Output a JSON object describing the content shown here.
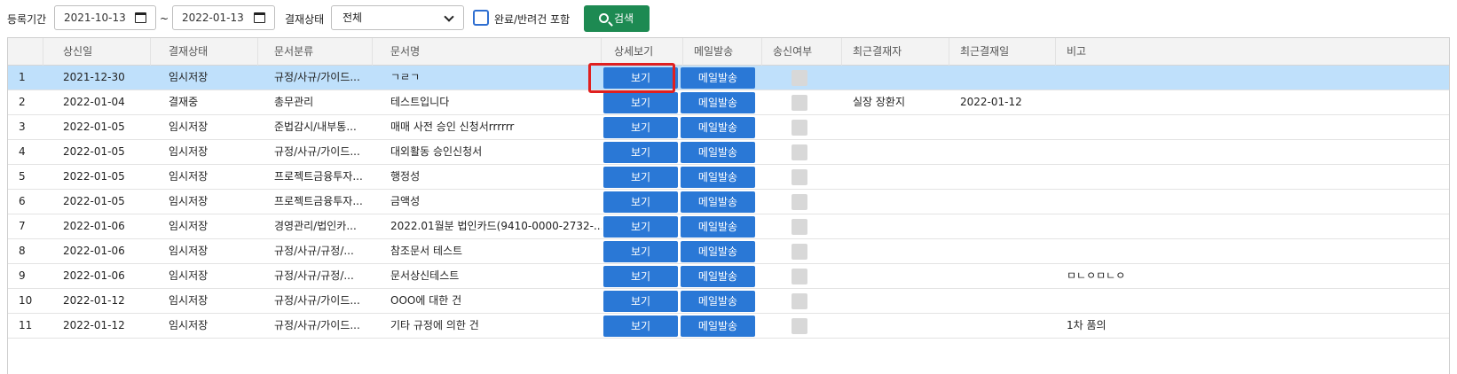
{
  "filter": {
    "period_label": "등록기간",
    "start_date": "2021-10-13",
    "tilde": "~",
    "end_date": "2022-01-13",
    "status_label": "결재상태",
    "status_value": "전체",
    "include_label": "완료/반려건 포함",
    "search_label": "검색"
  },
  "table": {
    "headers": [
      "상신일",
      "결재상태",
      "문서분류",
      "문서명",
      "상세보기",
      "메일발송",
      "송신여부",
      "최근결재자",
      "최근결재일",
      "비고"
    ],
    "view_label": "보기",
    "mail_label": "메일발송",
    "rows": [
      {
        "no": "1",
        "date": "2021-12-30",
        "status": "임시저장",
        "category": "규정/사규/가이드...",
        "name": "ㄱㄹㄱ",
        "approver": "",
        "approved_date": "",
        "note": ""
      },
      {
        "no": "2",
        "date": "2022-01-04",
        "status": "결재중",
        "category": "총무관리",
        "name": "테스트입니다",
        "approver": "실장 장환지",
        "approved_date": "2022-01-12",
        "note": ""
      },
      {
        "no": "3",
        "date": "2022-01-05",
        "status": "임시저장",
        "category": "준법감시/내부통...",
        "name": "매매 사전 승인 신청서rrrrrr",
        "approver": "",
        "approved_date": "",
        "note": ""
      },
      {
        "no": "4",
        "date": "2022-01-05",
        "status": "임시저장",
        "category": "규정/사규/가이드...",
        "name": "대외활동 승인신청서",
        "approver": "",
        "approved_date": "",
        "note": ""
      },
      {
        "no": "5",
        "date": "2022-01-05",
        "status": "임시저장",
        "category": "프로젝트금융투자...",
        "name": "행정성",
        "approver": "",
        "approved_date": "",
        "note": ""
      },
      {
        "no": "6",
        "date": "2022-01-05",
        "status": "임시저장",
        "category": "프로젝트금융투자...",
        "name": "금액성",
        "approver": "",
        "approved_date": "",
        "note": ""
      },
      {
        "no": "7",
        "date": "2022-01-06",
        "status": "임시저장",
        "category": "경영관리/법인카...",
        "name": "2022.01월분 법인카드(9410-0000-2732-...",
        "approver": "",
        "approved_date": "",
        "note": ""
      },
      {
        "no": "8",
        "date": "2022-01-06",
        "status": "임시저장",
        "category": "규정/사규/규정/...",
        "name": "참조문서 테스트",
        "approver": "",
        "approved_date": "",
        "note": ""
      },
      {
        "no": "9",
        "date": "2022-01-06",
        "status": "임시저장",
        "category": "규정/사규/규정/...",
        "name": "문서상신테스트",
        "approver": "",
        "approved_date": "",
        "note": "ㅁㄴㅇㅁㄴㅇ"
      },
      {
        "no": "10",
        "date": "2022-01-12",
        "status": "임시저장",
        "category": "규정/사규/가이드...",
        "name": "OOO에 대한 건",
        "approver": "",
        "approved_date": "",
        "note": ""
      },
      {
        "no": "11",
        "date": "2022-01-12",
        "status": "임시저장",
        "category": "규정/사규/가이드...",
        "name": "기타 규정에 의한 건",
        "approver": "",
        "approved_date": "",
        "note": "1차 품의"
      }
    ]
  },
  "colors": {
    "accent": "#2a78d6",
    "search_button": "#1d8a52",
    "selected_row": "#bfe0fb",
    "highlight": "#e02020"
  }
}
